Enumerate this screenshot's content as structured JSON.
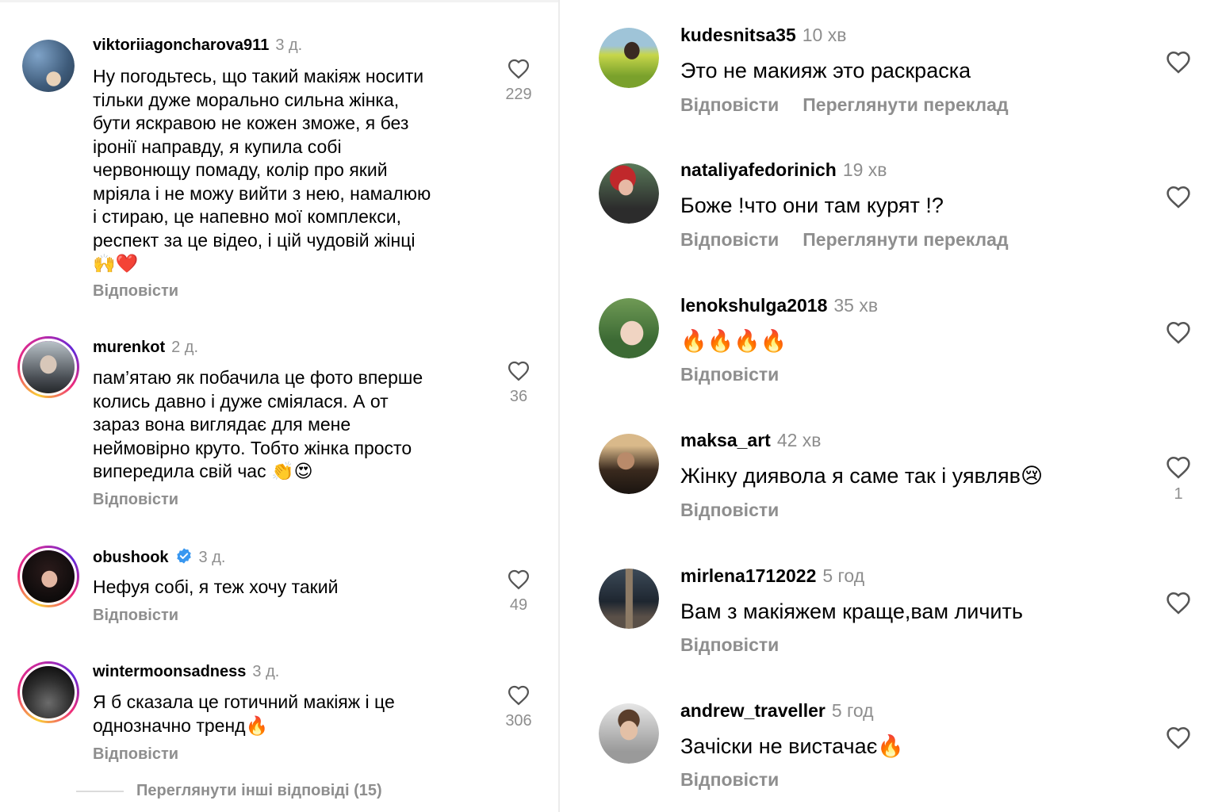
{
  "left_comments": [
    {
      "username": "viktoriiagoncharova911",
      "time": "3 д.",
      "text": "Ну погодьтесь, що такий макіяж носити\nтільки дуже морально сильна жінка,\nбути яскравою не кожен зможе, я без\nіронії направду, я купила собі\nчервонющу помаду, колір про який\nмріяла і не можу вийти з нею, намалюю\nі стираю, це напевно мої комплекси,\nреспект за це відео, і цій чудовій жінці\n🙌❤️",
      "reply": "Відповісти",
      "likes": "229"
    },
    {
      "username": "murenkot",
      "time": "2 д.",
      "text": "пам’ятаю як побачила це фото вперше\nколись давно і дуже сміялася. А от\nзараз вона виглядає для мене\nнеймовірно круто. Тобто жінка просто\nвипередила свій час 👏😍",
      "reply": "Відповісти",
      "likes": "36"
    },
    {
      "username": "obushook",
      "time": "3 д.",
      "text": "Нефуя собі, я теж хочу такий",
      "reply": "Відповісти",
      "likes": "49"
    },
    {
      "username": "wintermoonsadness",
      "time": "3 д.",
      "text": "Я б сказала це готичний макіяж і це\nоднозначно тренд🔥",
      "reply": "Відповісти",
      "likes": "306"
    }
  ],
  "more_replies": "Переглянути інші відповіді (15)",
  "right_comments": [
    {
      "username": "kudesnitsa35",
      "time": "10 хв",
      "text": "Это не макияж это раскраска",
      "reply": "Відповісти",
      "translate": "Переглянути переклад",
      "likes": ""
    },
    {
      "username": "nataliyafedorinich",
      "time": "19 хв",
      "text": "Боже !что они там курят !?",
      "reply": "Відповісти",
      "translate": "Переглянути переклад",
      "likes": ""
    },
    {
      "username": "lenokshulga2018",
      "time": "35 хв",
      "text": "🔥🔥🔥🔥",
      "reply": "Відповісти",
      "likes": ""
    },
    {
      "username": "maksa_art",
      "time": "42 хв",
      "text": "Жінку диявола я саме так і уявляв😢",
      "reply": "Відповісти",
      "likes": "1"
    },
    {
      "username": "mirlena1712022",
      "time": "5 год",
      "text": "Вам з макіяжем краще,вам личить",
      "reply": "Відповісти",
      "likes": ""
    },
    {
      "username": "andrew_traveller",
      "time": "5 год",
      "text": "Зачіски не вистачає🔥",
      "reply": "Відповісти",
      "likes": ""
    }
  ],
  "colors": {
    "muted": "#8e8e8e",
    "verified": "#3897f0",
    "ring_start": "#f9ce34",
    "ring_end": "#c32aa3"
  }
}
